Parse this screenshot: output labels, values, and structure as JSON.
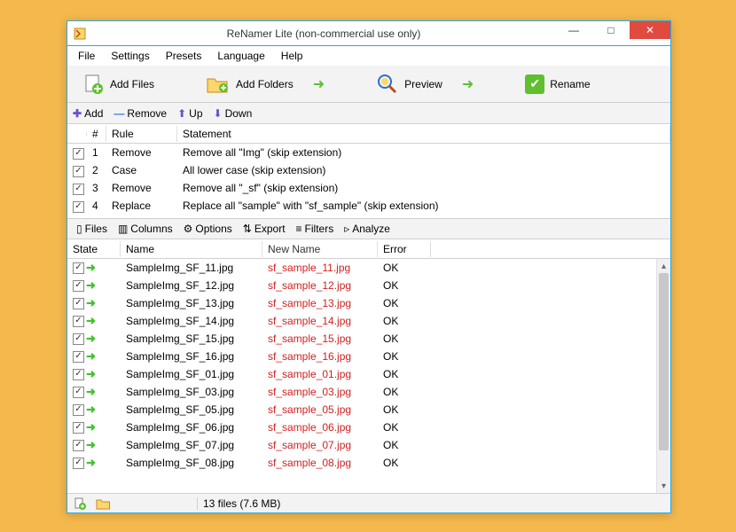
{
  "window": {
    "title": "ReNamer Lite (non-commercial use only)"
  },
  "menu": [
    "File",
    "Settings",
    "Presets",
    "Language",
    "Help"
  ],
  "toolbar": {
    "add_files": "Add Files",
    "add_folders": "Add Folders",
    "preview": "Preview",
    "rename": "Rename"
  },
  "rules_toolbar": {
    "add": "Add",
    "remove": "Remove",
    "up": "Up",
    "down": "Down"
  },
  "rules_header": {
    "num": "#",
    "rule": "Rule",
    "stmt": "Statement"
  },
  "rules": [
    {
      "n": "1",
      "rule": "Remove",
      "stmt": "Remove all \"Img\" (skip extension)"
    },
    {
      "n": "2",
      "rule": "Case",
      "stmt": "All lower case (skip extension)"
    },
    {
      "n": "3",
      "rule": "Remove",
      "stmt": "Remove all \"_sf\" (skip extension)"
    },
    {
      "n": "4",
      "rule": "Replace",
      "stmt": "Replace all \"sample\" with \"sf_sample\" (skip extension)"
    }
  ],
  "files_toolbar": [
    "Files",
    "Columns",
    "Options",
    "Export",
    "Filters",
    "Analyze"
  ],
  "files_header": {
    "state": "State",
    "name": "Name",
    "newname": "New Name",
    "error": "Error"
  },
  "files": [
    {
      "name": "SampleImg_SF_11.jpg",
      "newname": "sf_sample_11.jpg",
      "error": "OK"
    },
    {
      "name": "SampleImg_SF_12.jpg",
      "newname": "sf_sample_12.jpg",
      "error": "OK"
    },
    {
      "name": "SampleImg_SF_13.jpg",
      "newname": "sf_sample_13.jpg",
      "error": "OK"
    },
    {
      "name": "SampleImg_SF_14.jpg",
      "newname": "sf_sample_14.jpg",
      "error": "OK"
    },
    {
      "name": "SampleImg_SF_15.jpg",
      "newname": "sf_sample_15.jpg",
      "error": "OK"
    },
    {
      "name": "SampleImg_SF_16.jpg",
      "newname": "sf_sample_16.jpg",
      "error": "OK"
    },
    {
      "name": "SampleImg_SF_01.jpg",
      "newname": "sf_sample_01.jpg",
      "error": "OK"
    },
    {
      "name": "SampleImg_SF_03.jpg",
      "newname": "sf_sample_03.jpg",
      "error": "OK"
    },
    {
      "name": "SampleImg_SF_05.jpg",
      "newname": "sf_sample_05.jpg",
      "error": "OK"
    },
    {
      "name": "SampleImg_SF_06.jpg",
      "newname": "sf_sample_06.jpg",
      "error": "OK"
    },
    {
      "name": "SampleImg_SF_07.jpg",
      "newname": "sf_sample_07.jpg",
      "error": "OK"
    },
    {
      "name": "SampleImg_SF_08.jpg",
      "newname": "sf_sample_08.jpg",
      "error": "OK"
    }
  ],
  "statusbar": {
    "text": "13 files (7.6 MB)"
  }
}
